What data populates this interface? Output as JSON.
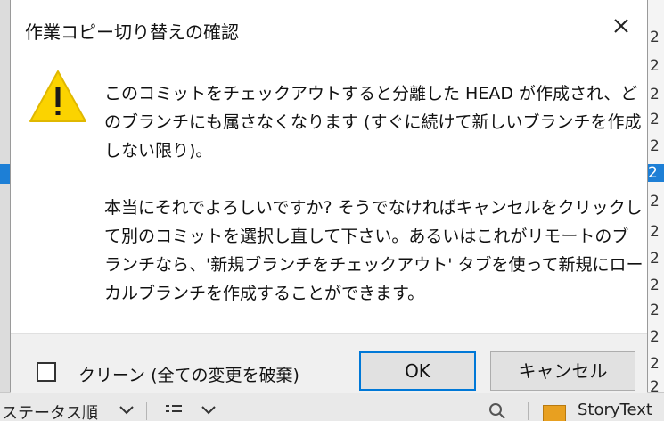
{
  "background": {
    "right_column_chars": [
      "2",
      "2",
      "2",
      "2",
      "2",
      "2",
      "2",
      "2",
      "2",
      "2",
      "2",
      "2",
      "2",
      "2"
    ],
    "bottom_toolbar": {
      "sort_label": "ステータス順",
      "story_text": "StoryText"
    }
  },
  "dialog": {
    "title": "作業コピー切り替えの確認",
    "message_paragraph_1": "このコミットをチェックアウトすると分離した HEAD が作成され、どのブランチにも属さなくなります (すぐに続けて新しいブランチを作成しない限り)。",
    "message_paragraph_2": "本当にそれでよろしいですか? そうでなければキャンセルをクリックして別のコミットを選択し直して下さい。あるいはこれがリモートのブランチなら、'新規ブランチをチェックアウト' タブを使って新規にローカルブランチを作成することができます。",
    "checkbox": {
      "label": "クリーン (全ての変更を破棄)",
      "checked": false
    },
    "ok_label": "OK",
    "cancel_label": "キャンセル"
  },
  "colors": {
    "accent": "#0078d7",
    "warning": "#fbd300",
    "selection": "#1d7fd6"
  },
  "icons": {
    "warning": "warning-icon",
    "close": "close-icon"
  }
}
